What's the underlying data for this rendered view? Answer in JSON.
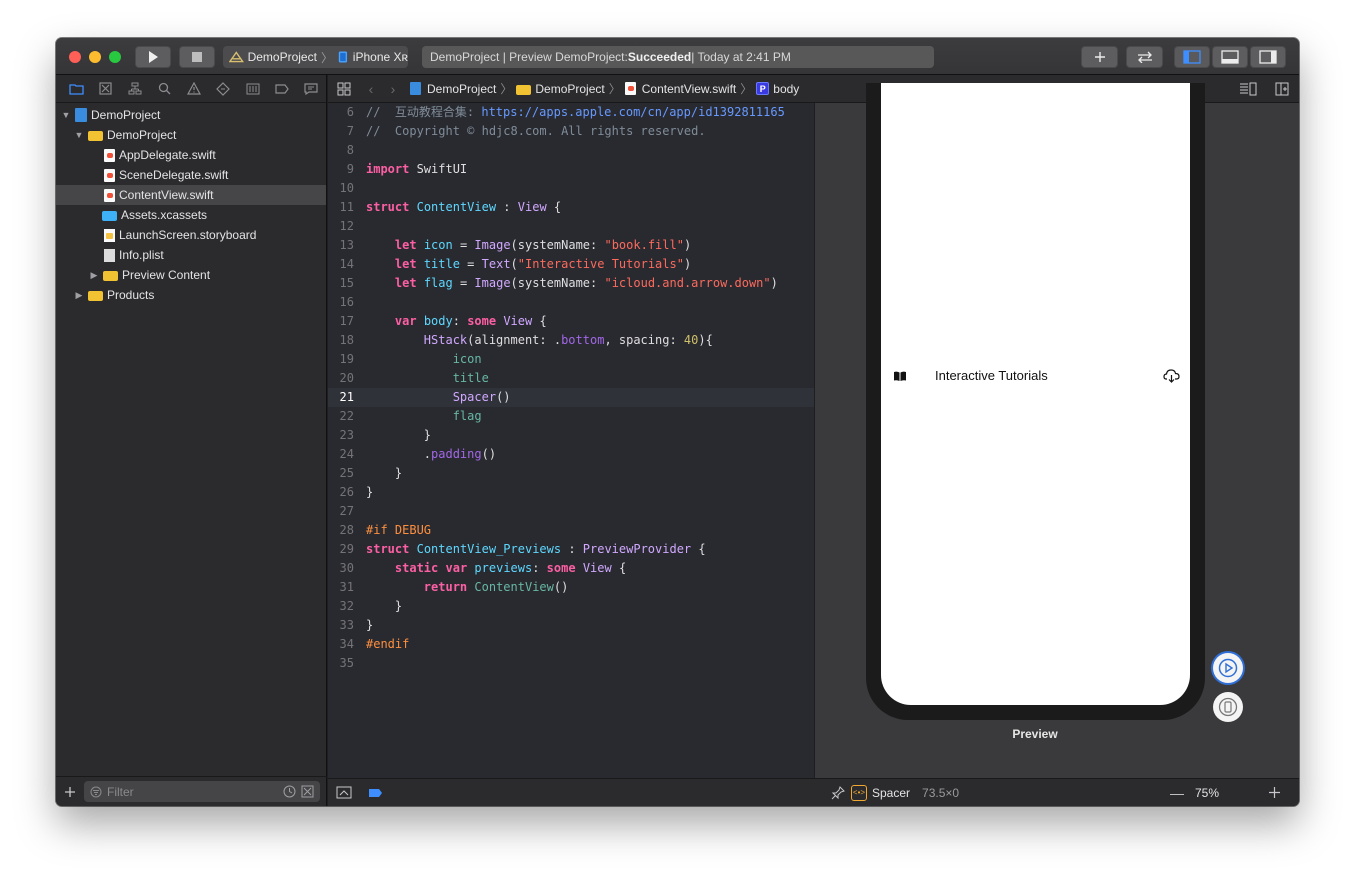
{
  "toolbar": {
    "scheme_project": "DemoProject",
    "scheme_device": "iPhone Xʀ",
    "activity_prefix": "DemoProject | Preview DemoProject: ",
    "activity_status": "Succeeded",
    "activity_time": " | Today at 2:41 PM"
  },
  "navigator": {
    "items": [
      {
        "label": "DemoProject",
        "kind": "project"
      },
      {
        "label": "DemoProject",
        "kind": "folder"
      },
      {
        "label": "AppDelegate.swift",
        "kind": "swift"
      },
      {
        "label": "SceneDelegate.swift",
        "kind": "swift"
      },
      {
        "label": "ContentView.swift",
        "kind": "swift",
        "selected": true
      },
      {
        "label": "Assets.xcassets",
        "kind": "assets"
      },
      {
        "label": "LaunchScreen.storyboard",
        "kind": "storyboard"
      },
      {
        "label": "Info.plist",
        "kind": "plist"
      },
      {
        "label": "Preview Content",
        "kind": "folder"
      },
      {
        "label": "Products",
        "kind": "folder"
      }
    ],
    "filter_placeholder": "Filter"
  },
  "jumpbar": {
    "crumbs": [
      "DemoProject",
      "DemoProject",
      "ContentView.swift",
      "body"
    ],
    "symbol_badge": "P"
  },
  "editor": {
    "current_line": 21,
    "lines": [
      {
        "n": "6",
        "html": "<span class='cm'>//  互动教程合集: </span><span class='url'>https://apps.apple.com/cn/app/id1392811165</span>"
      },
      {
        "n": "7",
        "html": "<span class='cm'>//  Copyright © hdjc8.com. All rights reserved.</span>"
      },
      {
        "n": "8",
        "html": ""
      },
      {
        "n": "9",
        "html": "<span class='kw'>import</span> SwiftUI"
      },
      {
        "n": "10",
        "html": ""
      },
      {
        "n": "11",
        "html": "<span class='kw'>struct</span> <span class='ty'>ContentView</span> : <span class='sy'>View</span> {"
      },
      {
        "n": "12",
        "html": ""
      },
      {
        "n": "13",
        "html": "    <span class='kw'>let</span> <span class='ty'>icon</span> = <span class='sy'>Image</span>(systemName: <span class='st'>\"book.fill\"</span>)"
      },
      {
        "n": "14",
        "html": "    <span class='kw'>let</span> <span class='ty'>title</span> = <span class='sy'>Text</span>(<span class='st'>\"Interactive Tutorials\"</span>)"
      },
      {
        "n": "15",
        "html": "    <span class='kw'>let</span> <span class='ty'>flag</span> = <span class='sy'>Image</span>(systemName: <span class='st'>\"icloud.and.arrow.down\"</span>)"
      },
      {
        "n": "16",
        "html": ""
      },
      {
        "n": "17",
        "html": "    <span class='kw'>var</span> <span class='ty'>body</span>: <span class='kw'>some</span> <span class='sy'>View</span> {"
      },
      {
        "n": "18",
        "html": "        <span class='sy'>HStack</span>(alignment: .<span class='pr'>bottom</span>, spacing: <span class='nm'>40</span>){"
      },
      {
        "n": "19",
        "html": "            <span class='fn'>icon</span>"
      },
      {
        "n": "20",
        "html": "            <span class='fn'>title</span>"
      },
      {
        "n": "21",
        "html": "            <span class='sy'>Spacer</span>()"
      },
      {
        "n": "22",
        "html": "            <span class='fn'>flag</span>"
      },
      {
        "n": "23",
        "html": "        }"
      },
      {
        "n": "24",
        "html": "        .<span class='pr'>padding</span>()"
      },
      {
        "n": "25",
        "html": "    }"
      },
      {
        "n": "26",
        "html": "}"
      },
      {
        "n": "27",
        "html": ""
      },
      {
        "n": "28",
        "html": "<span class='md'>#if DEBUG</span>"
      },
      {
        "n": "29",
        "html": "<span class='kw'>struct</span> <span class='ty'>ContentView_Previews</span> : <span class='sy'>PreviewProvider</span> {"
      },
      {
        "n": "30",
        "html": "    <span class='kw'>static</span> <span class='kw'>var</span> <span class='ty'>previews</span>: <span class='kw'>some</span> <span class='sy'>View</span> {"
      },
      {
        "n": "31",
        "html": "        <span class='kw'>return</span> <span class='cr'>ContentView</span>()"
      },
      {
        "n": "32",
        "html": "    }"
      },
      {
        "n": "33",
        "html": "}"
      },
      {
        "n": "34",
        "html": "<span class='md'>#endif</span>"
      },
      {
        "n": "35",
        "html": ""
      }
    ]
  },
  "preview": {
    "title_text": "Interactive Tutorials",
    "label": "Preview",
    "selection_name": "Spacer",
    "selection_size": "73.5×0",
    "zoom": "75%"
  },
  "colors": {
    "accent": "#3e8eff",
    "keyword": "#fc5fa3",
    "type": "#5dd8ff",
    "string": "#fc6a5d",
    "comment": "#7f8c98"
  }
}
